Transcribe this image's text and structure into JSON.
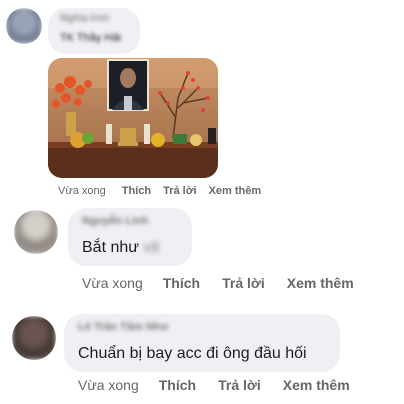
{
  "comments": [
    {
      "author": "Nghia Iron",
      "text": "TK Thầy Hải",
      "actions": {
        "time": "Vừa xong",
        "like": "Thích",
        "reply": "Trả lời",
        "more": "Xem thêm"
      }
    },
    {
      "author": "Nguyễn Linh",
      "text": "Bắt như",
      "text_hidden": "vịt",
      "actions": {
        "time": "Vừa xong",
        "like": "Thích",
        "reply": "Trả lời",
        "more": "Xem thêm"
      }
    },
    {
      "author": "Lê Trần Tâm Như",
      "text": "Chuẩn bị bay acc đi ông đầu hối",
      "actions": {
        "time": "Vừa xong",
        "like": "Thích",
        "reply": "Trả lời",
        "more": "Xem thêm"
      }
    }
  ],
  "colors": {
    "bubble": "#eef0f3",
    "secondary_text": "#65676b",
    "primary_text": "#1c1e21"
  }
}
